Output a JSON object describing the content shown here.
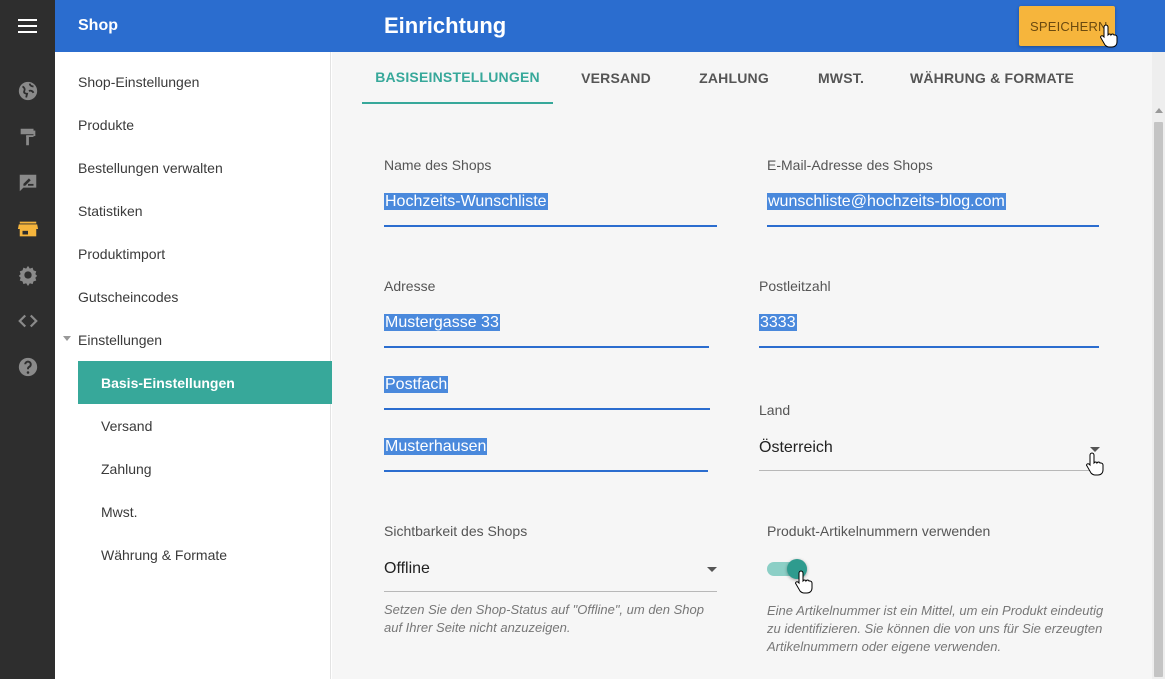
{
  "app": {
    "shop_name": "Shop",
    "page_title": "Einrichtung",
    "save_label": "SPEICHERN"
  },
  "rail": {
    "icons": [
      "menu-icon",
      "globe-icon",
      "paint-roller-icon",
      "edit-note-icon",
      "store-icon",
      "gear-icon",
      "code-icon",
      "help-icon"
    ],
    "active_icon": "store-icon",
    "active_color": "#f6b53c"
  },
  "sidebar": {
    "items": [
      {
        "label": "Shop-Einstellungen"
      },
      {
        "label": "Produkte"
      },
      {
        "label": "Bestellungen verwalten"
      },
      {
        "label": "Statistiken"
      },
      {
        "label": "Produktimport"
      },
      {
        "label": "Gutscheincodes"
      },
      {
        "label": "Einstellungen"
      }
    ],
    "subitems": [
      {
        "label": "Basis-Einstellungen"
      },
      {
        "label": "Versand"
      },
      {
        "label": "Zahlung"
      },
      {
        "label": "Mwst."
      },
      {
        "label": "Währung & Formate"
      }
    ],
    "active_subitem": "Basis-Einstellungen"
  },
  "tabs": [
    {
      "label": "BASISEINSTELLUNGEN"
    },
    {
      "label": "VERSAND"
    },
    {
      "label": "ZAHLUNG"
    },
    {
      "label": "MWST."
    },
    {
      "label": "WÄHRUNG & FORMATE"
    }
  ],
  "active_tab": "BASISEINSTELLUNGEN",
  "form": {
    "shop_name": {
      "label": "Name des Shops",
      "value": "Hochzeits-Wunschliste"
    },
    "shop_email": {
      "label": "E-Mail-Adresse des Shops",
      "value": "wunschliste@hochzeits-blog.com"
    },
    "address": {
      "label": "Adresse",
      "value": "Mustergasse 33"
    },
    "zip": {
      "label": "Postleitzahl",
      "value": "3333"
    },
    "po_box": {
      "value": "Postfach"
    },
    "city": {
      "value": "Musterhausen"
    },
    "country": {
      "label": "Land",
      "value": "Österreich"
    },
    "visibility": {
      "label": "Sichtbarkeit des Shops",
      "value": "Offline",
      "hint": "Setzen Sie den Shop-Status auf \"Offline\", um den Shop auf Ihrer Seite nicht anzuzeigen."
    },
    "sku": {
      "label": "Produkt-Artikelnummern verwenden",
      "enabled": true,
      "hint": "Eine Artikelnummer ist ein Mittel, um ein Produkt eindeutig zu identifizieren. Sie können die von uns für Sie erzeugten Artikelnummern oder eigene verwenden."
    }
  },
  "colors": {
    "topbar": "#2b6dcf",
    "accent": "#37a89a",
    "save_button": "#f6b53c",
    "rail": "#2e2e2e",
    "selection": "#4a89dc"
  }
}
